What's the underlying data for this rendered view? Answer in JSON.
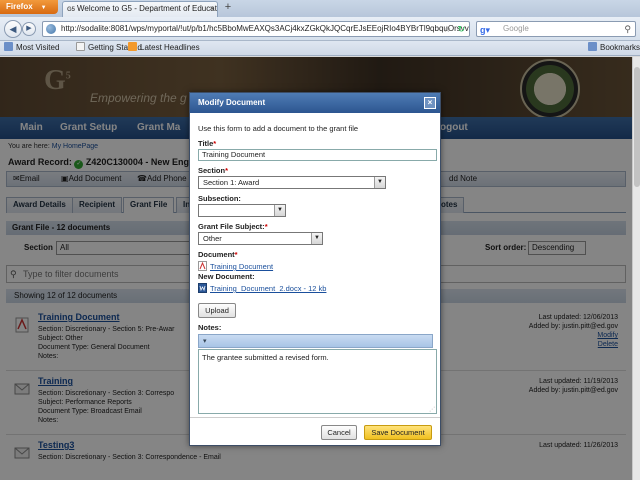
{
  "browser": {
    "menu_label": "Firefox",
    "tab_title": "Welcome to G5 - Department of Educati...",
    "tab_fav": "G5",
    "url": "http://sodalite:8081/wps/myportal/!ut/p/b1/hc5BboMwEAXQs3ACj4kxZGkQkJQCqrEJsEEojRIo4BYBrTl9qbquOrsvv",
    "search_placeholder": "Google",
    "bookmarks": [
      "Most Visited",
      "Getting Started",
      "Latest Headlines"
    ],
    "bookmarks_right": "Bookmarks"
  },
  "page": {
    "tagline": "Empowering the g",
    "nav": [
      "Main",
      "Grant Setup",
      "Grant Ma",
      "ogout"
    ],
    "breadcrumb_prefix": "You are here:",
    "breadcrumb_link": "My HomePage",
    "award_record": "Award Record:",
    "award_id": "Z420C130004 - New England",
    "actions": [
      "Email",
      "Add Document",
      "Add Phone",
      "dd Note"
    ],
    "tabs": [
      "Award Details",
      "Recipient",
      "Grant File",
      "In",
      "otes"
    ],
    "grant_file_header": "Grant File - 12 documents",
    "section_label": "Section",
    "section_value": "All",
    "sort_label": "Sort order:",
    "sort_value": "Descending",
    "filter_placeholder": "Type to filter documents",
    "showing": "Showing 12 of 12 documents",
    "documents": [
      {
        "title": "Training Document",
        "section": "Section: Discretionary - Section 5: Pre-Awar",
        "subject": "Subject: Other",
        "doctype": "Document Type: General Document",
        "notes": "Notes:",
        "updated": "Last updated: 12/06/2013",
        "added": "Added by: justin.pitt@ed.gov",
        "modify": "Modify",
        "delete": "Delete"
      },
      {
        "title": "Training",
        "section": "Section: Discretionary - Section 3: Correspo",
        "subject": "Subject: Performance Reports",
        "doctype": "Document Type: Broadcast Email",
        "notes": "Notes:",
        "updated": "Last updated: 11/19/2013",
        "added": "Added by: justin.pitt@ed.gov",
        "modify": "",
        "delete": ""
      },
      {
        "title": "Testing3",
        "section": "Section: Discretionary - Section 3: Correspondence - Email",
        "subject": "",
        "doctype": "",
        "notes": "",
        "updated": "Last updated: 11/26/2013",
        "added": "",
        "modify": "",
        "delete": ""
      }
    ]
  },
  "modal": {
    "title": "Modify Document",
    "intro": "Use this form to add a document to the grant file",
    "title_label": "Title",
    "title_value": "Training Document",
    "section_label": "Section",
    "section_value": "Section 1: Award",
    "subsection_label": "Subsection:",
    "subsection_value": "",
    "subject_label": "Grant File Subject:",
    "subject_value": "Other",
    "document_label": "Document",
    "document_link": "Training Document",
    "new_document_label": "New Document:",
    "new_document_link": "Training_Document_2.docx - 12 kb",
    "upload_label": "Upload",
    "notes_label": "Notes:",
    "notes_value": "The grantee submitted a revised form.",
    "cancel_label": "Cancel",
    "save_label": "Save Document",
    "required_mark": "*"
  },
  "colors": {
    "modal_header": "#2c5590",
    "primary_button": "#f0c020",
    "link": "#1a4f9c",
    "required": "#cc0000"
  }
}
